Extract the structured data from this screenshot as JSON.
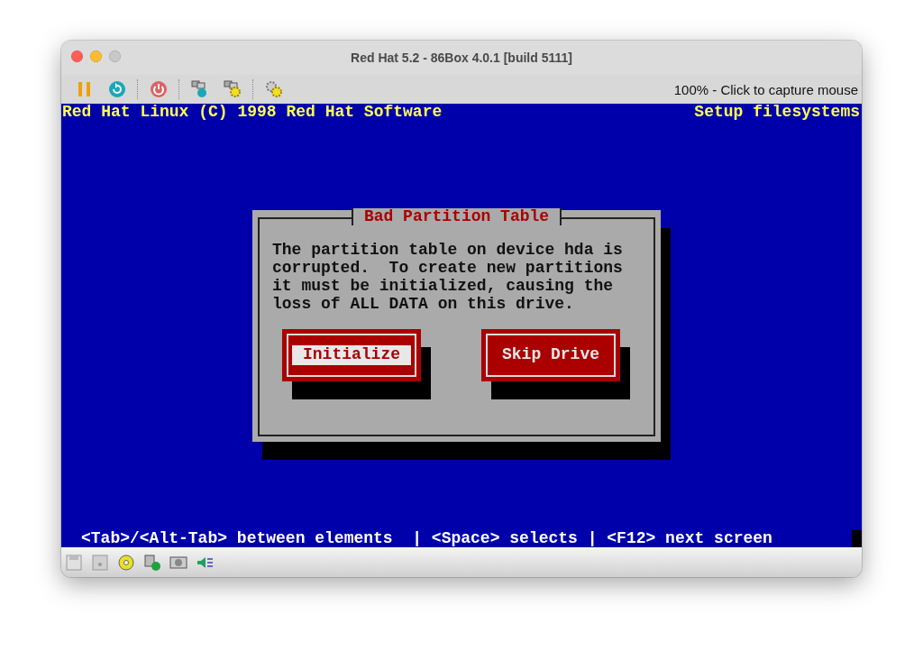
{
  "window": {
    "title": "Red Hat 5.2 - 86Box 4.0.1 [build 5111]"
  },
  "toolbar": {
    "status": "100% - Click to capture mouse"
  },
  "screen": {
    "header_left": "Red Hat Linux (C) 1998 Red Hat Software",
    "header_right": "Setup filesystems",
    "dialog": {
      "title": "Bad Partition Table",
      "message": "The partition table on device hda is\ncorrupted.  To create new partitions\nit must be initialized, causing the\nloss of ALL DATA on this drive.",
      "buttons": [
        {
          "label": "Initialize",
          "selected": true
        },
        {
          "label": "Skip Drive",
          "selected": false
        }
      ]
    },
    "help_line": "<Tab>/<Alt-Tab> between elements  | <Space> selects | <F12> next screen"
  }
}
